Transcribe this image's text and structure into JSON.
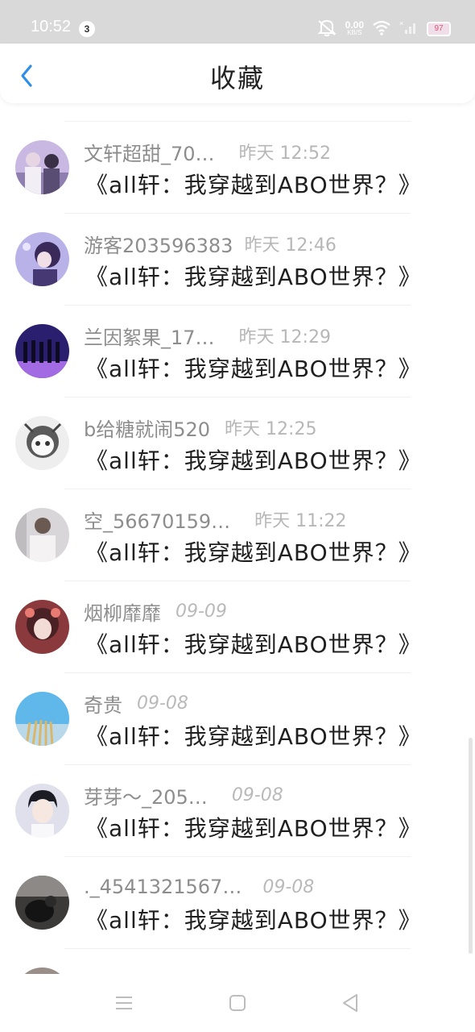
{
  "status_bar": {
    "time": "10:52",
    "notification_count": "3",
    "net_speed_value": "0.00",
    "net_speed_unit": "KB/S",
    "battery": "97"
  },
  "header": {
    "title": "收藏"
  },
  "items": [
    {
      "username": "文轩超甜_70…",
      "time": "昨天 12:52",
      "book_title": "《all轩：我穿越到ABO世界？》"
    },
    {
      "username": "游客203596383",
      "time": "昨天 12:46",
      "book_title": "《all轩：我穿越到ABO世界？》"
    },
    {
      "username": "兰因絮果_17…",
      "time": "昨天 12:29",
      "book_title": "《all轩：我穿越到ABO世界？》"
    },
    {
      "username": "b给糖就闹520",
      "time": "昨天 12:25",
      "book_title": "《all轩：我穿越到ABO世界？》"
    },
    {
      "username": "空_56670159…",
      "time": "昨天 11:22",
      "book_title": "《all轩：我穿越到ABO世界？》"
    },
    {
      "username": "烟柳靡靡",
      "time": "09-09",
      "book_title": "《all轩：我穿越到ABO世界？》"
    },
    {
      "username": "奇贵",
      "time": "09-08",
      "book_title": "《all轩：我穿越到ABO世界？》"
    },
    {
      "username": "芽芽～_205…",
      "time": "09-08",
      "book_title": "《all轩：我穿越到ABO世界？》"
    },
    {
      "username": "._4541321567…",
      "time": "09-08",
      "book_title": "《all轩：我穿越到ABO世界？》"
    },
    {
      "username": "",
      "time": "",
      "book_title": ""
    }
  ],
  "colors": {
    "accent": "#2f8fe6",
    "status_bar_bg": "#d9d9d9",
    "username_text": "#8d8d8d",
    "title_text": "#1f1f1f"
  },
  "icons": [
    "back-chevron-icon",
    "mute-icon",
    "wifi-icon",
    "signal-icon",
    "battery-icon",
    "menu-icon",
    "home-square-icon",
    "back-triangle-icon"
  ]
}
